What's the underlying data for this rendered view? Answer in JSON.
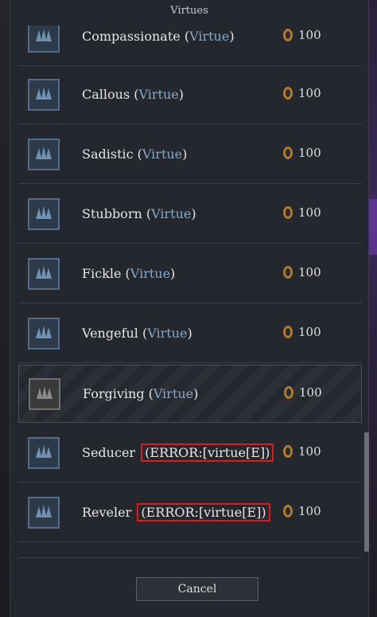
{
  "dialog": {
    "title": "Virtues",
    "cancel_label": "Cancel"
  },
  "virtues": [
    {
      "name": "Compassionate",
      "tag": "Virtue",
      "cost": "100"
    },
    {
      "name": "Callous",
      "tag": "Virtue",
      "cost": "100"
    },
    {
      "name": "Sadistic",
      "tag": "Virtue",
      "cost": "100"
    },
    {
      "name": "Stubborn",
      "tag": "Virtue",
      "cost": "100"
    },
    {
      "name": "Fickle",
      "tag": "Virtue",
      "cost": "100"
    },
    {
      "name": "Vengeful",
      "tag": "Virtue",
      "cost": "100"
    },
    {
      "name": "Forgiving",
      "tag": "Virtue",
      "cost": "100"
    },
    {
      "name": "Seducer",
      "tag": "ERROR:[virtue[E]",
      "cost": "100",
      "error": true
    },
    {
      "name": "Reveler",
      "tag": "ERROR:[virtue[E]",
      "cost": "100",
      "error": true
    }
  ],
  "colors": {
    "panel": "#24272d",
    "virtue_tag": "#86a9c8",
    "error_box": "#e11a1a"
  },
  "icons": {
    "virtue_icon": "hands-icon",
    "cost_icon": "coin-icon"
  }
}
